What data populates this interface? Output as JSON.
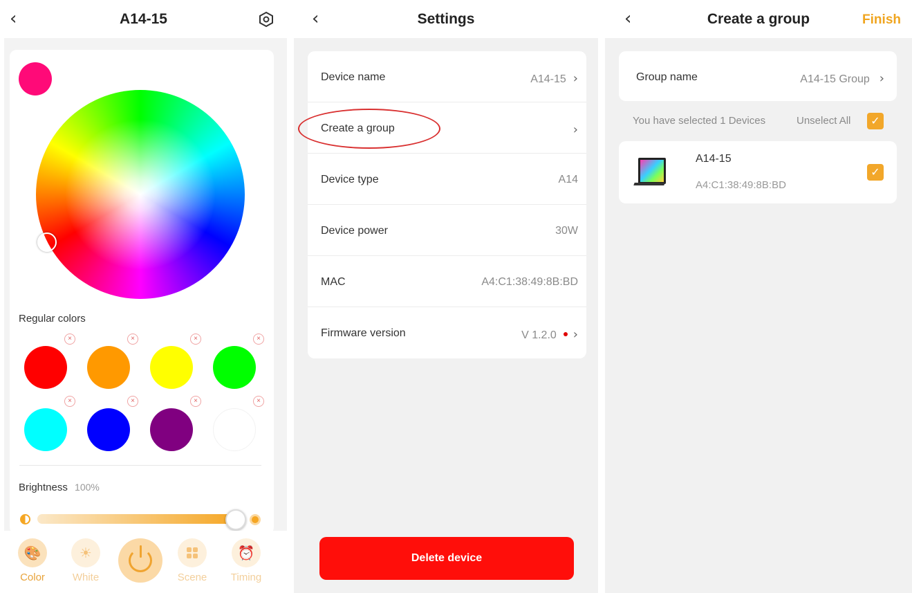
{
  "light_control": {
    "title": "A14-15",
    "current_color": "#ff0a78",
    "regular_colors_label": "Regular colors",
    "regular_colors": [
      "#ff0000",
      "#ff9900",
      "#ffff00",
      "#00ff00",
      "#00ffff",
      "#0000ff",
      "#800080",
      "#ffffff"
    ],
    "brightness_label": "Brightness",
    "brightness_value": "100%",
    "brightness_level": 1.0,
    "nav": [
      {
        "label": "Color",
        "icon": "palette-icon",
        "active": true
      },
      {
        "label": "White",
        "icon": "sun-icon",
        "active": false
      },
      {
        "label": "",
        "icon": "power-icon",
        "active": false
      },
      {
        "label": "Scene",
        "icon": "grid-icon",
        "active": false
      },
      {
        "label": "Timing",
        "icon": "alarm-clock-icon",
        "active": false
      }
    ]
  },
  "settings": {
    "title": "Settings",
    "rows": [
      {
        "label": "Device name",
        "value": "A14-15",
        "chevron": true
      },
      {
        "label": "Create a group",
        "value": "",
        "chevron": true
      },
      {
        "label": "Device type",
        "value": "A14",
        "chevron": false
      },
      {
        "label": "Device power",
        "value": "30W",
        "chevron": false
      },
      {
        "label": "MAC",
        "value": "A4:C1:38:49:8B:BD",
        "chevron": false
      },
      {
        "label": "Firmware version",
        "value": "V 1.2.0",
        "chevron": true
      }
    ],
    "delete_label": "Delete device",
    "delete_color": "#ff0e0a"
  },
  "create_group": {
    "title": "Create a group",
    "finish_label": "Finish",
    "group_name_label": "Group name",
    "group_name_value": "A14-15 Group",
    "selected_info": "You have selected 1 Devices",
    "unselect_all": "Unselect All",
    "device": {
      "name": "A14-15",
      "mac": "A4:C1:38:49:8B:BD"
    },
    "accent": "#f2a72a"
  }
}
